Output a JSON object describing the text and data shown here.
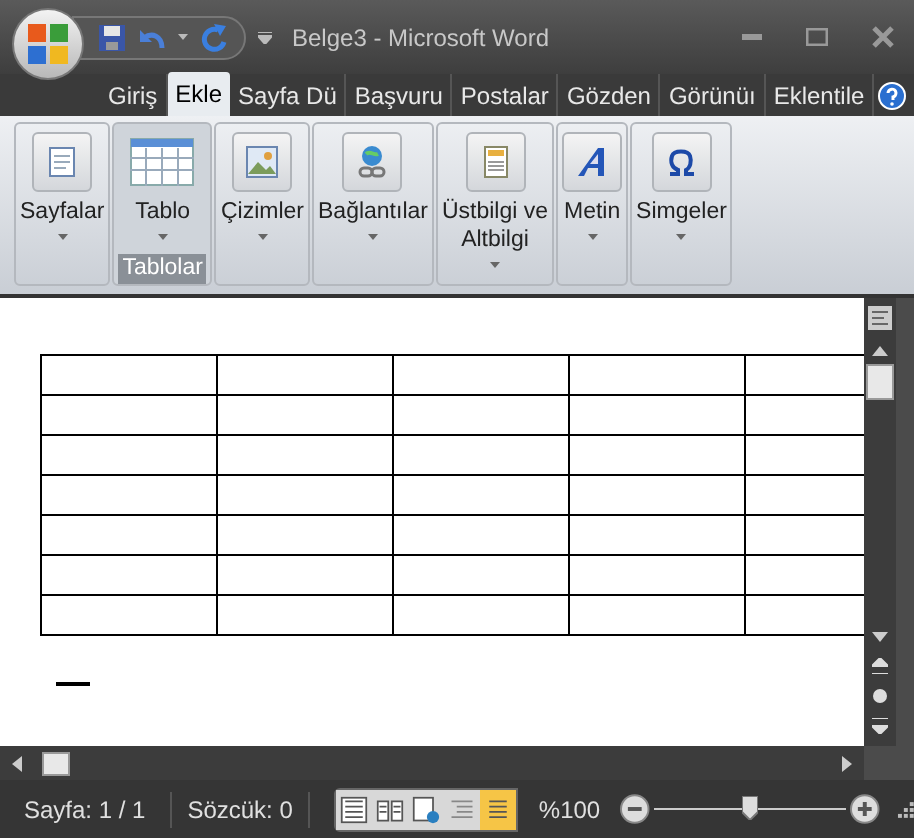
{
  "window": {
    "title": "Belge3 - Microsoft Word"
  },
  "tabs": [
    {
      "label": "Giriş",
      "selected": false
    },
    {
      "label": "Ekle",
      "selected": true
    },
    {
      "label": "Sayfa Dü",
      "selected": false
    },
    {
      "label": "Başvuru",
      "selected": false
    },
    {
      "label": "Postalar",
      "selected": false
    },
    {
      "label": "Gözden",
      "selected": false
    },
    {
      "label": "Görünüı",
      "selected": false
    },
    {
      "label": "Eklentile",
      "selected": false
    }
  ],
  "ribbon": {
    "groups": [
      {
        "kind": "page",
        "lines": [
          "Sayfalar"
        ],
        "selected": false
      },
      {
        "kind": "table",
        "lines": [
          "Tablo"
        ],
        "selected": true,
        "group_label": "Tablolar"
      },
      {
        "kind": "image",
        "lines": [
          "Çizimler"
        ],
        "selected": false
      },
      {
        "kind": "link",
        "lines": [
          "Bağlantılar"
        ],
        "selected": false
      },
      {
        "kind": "header",
        "lines": [
          "Üstbilgi ve",
          "Altbilgi"
        ],
        "selected": false
      },
      {
        "kind": "text",
        "lines": [
          "Metin"
        ],
        "selected": false
      },
      {
        "kind": "symbol",
        "lines": [
          "Simgeler"
        ],
        "selected": false
      }
    ]
  },
  "status_bar": {
    "page": "Sayfa: 1 / 1",
    "words": "Sözcük: 0",
    "views": [
      {
        "kind": "print",
        "selected": false
      },
      {
        "kind": "reading",
        "selected": false
      },
      {
        "kind": "web",
        "selected": false
      },
      {
        "kind": "outline",
        "selected": false
      },
      {
        "kind": "draft",
        "selected": true
      }
    ],
    "zoom": "%100",
    "zoom_level": {
      "level": 0.5
    }
  }
}
